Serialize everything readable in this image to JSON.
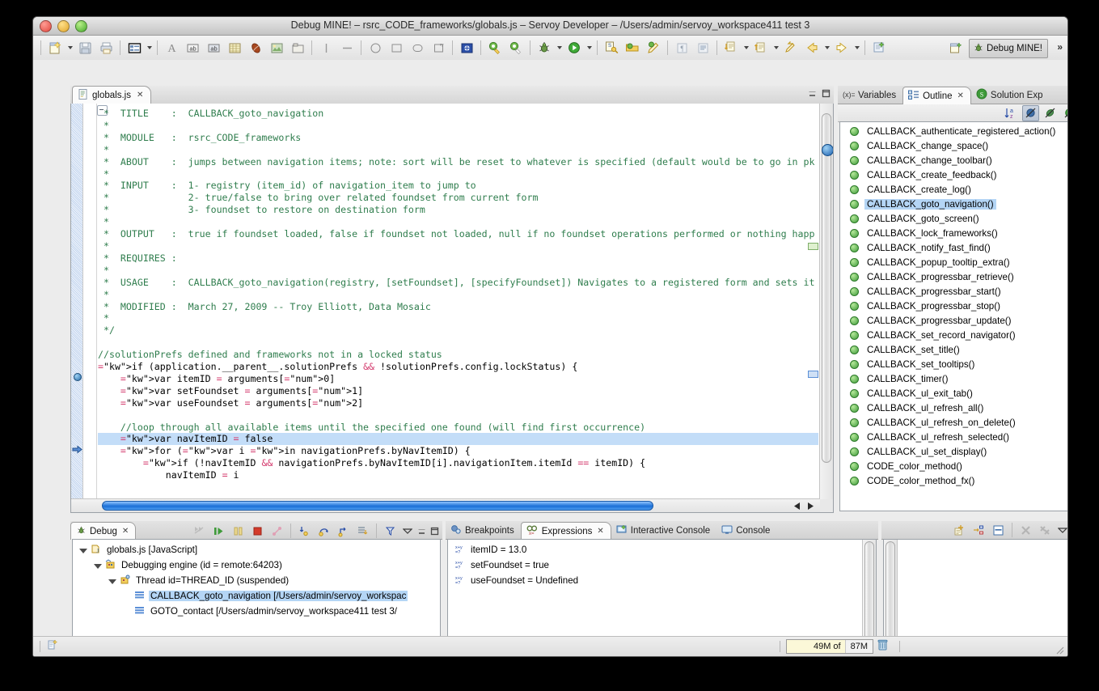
{
  "window": {
    "title": "Debug MINE! – rsrc_CODE_frameworks/globals.js – Servoy Developer – /Users/admin/servoy_workspace411 test 3",
    "controls": {
      "close": "close-button",
      "minimize": "minimize-button",
      "zoom": "zoom-button"
    }
  },
  "toolbar": {
    "groups": [
      {
        "items": [
          {
            "name": "new-wizard-icon",
            "label": "New",
            "dropdown": true
          },
          {
            "name": "save-icon",
            "label": "Save",
            "dropdown": false
          },
          {
            "name": "print-icon",
            "label": "Print",
            "dropdown": false
          }
        ]
      },
      {
        "items": [
          {
            "name": "form-editor-icon",
            "label": "New Form",
            "dropdown": true
          }
        ]
      },
      {
        "items": [
          {
            "name": "label-tool-icon",
            "label": "Place Label",
            "dropdown": false
          },
          {
            "name": "text-field-icon",
            "label": "Place Field",
            "dropdown": false
          },
          {
            "name": "text-area-icon",
            "label": "Place Text Area",
            "dropdown": false
          },
          {
            "name": "portal-icon",
            "label": "Place Portal",
            "dropdown": false
          },
          {
            "name": "bean-icon",
            "label": "Place Bean",
            "dropdown": false
          },
          {
            "name": "image-icon",
            "label": "Place Image",
            "dropdown": false
          },
          {
            "name": "tabpanel-icon",
            "label": "Place Tab Panel",
            "dropdown": false
          }
        ]
      },
      {
        "items": [
          {
            "name": "vertical-line-icon",
            "label": "Vertical Line",
            "dropdown": false
          },
          {
            "name": "horizontal-line-icon",
            "label": "Horizontal Line",
            "dropdown": false
          }
        ]
      },
      {
        "items": [
          {
            "name": "circle-shape-icon",
            "label": "Circle",
            "dropdown": false
          },
          {
            "name": "rect-shape-icon",
            "label": "Rectangle",
            "dropdown": false
          },
          {
            "name": "rounded-rect-icon",
            "label": "Rounded Rect",
            "dropdown": false
          },
          {
            "name": "polygon-icon",
            "label": "Polygon",
            "dropdown": false
          }
        ]
      },
      {
        "items": [
          {
            "name": "i18n-flag-icon",
            "label": "I18N",
            "dropdown": false
          }
        ]
      },
      {
        "items": [
          {
            "name": "profile-yellow-icon",
            "label": "Profile",
            "dropdown": false
          },
          {
            "name": "profile-white-icon",
            "label": "Profile Method",
            "dropdown": false
          }
        ]
      },
      {
        "items": [
          {
            "name": "debug-bug-icon",
            "label": "Debug",
            "dropdown": true
          },
          {
            "name": "run-play-icon",
            "label": "Run",
            "dropdown": true
          }
        ]
      },
      {
        "items": [
          {
            "name": "solution-key-icon",
            "label": "Solution",
            "dropdown": false
          },
          {
            "name": "open-folder-icon",
            "label": "Open",
            "dropdown": false
          },
          {
            "name": "pencil-edit-icon",
            "label": "Edit",
            "dropdown": false
          }
        ]
      },
      {
        "items": [
          {
            "name": "paragraph-mark-icon",
            "label": "Show Whitespace",
            "dropdown": false
          },
          {
            "name": "page-break-icon",
            "label": "Page Break",
            "dropdown": false
          }
        ]
      },
      {
        "items": [
          {
            "name": "next-annotation-icon",
            "label": "Next Annotation",
            "dropdown": true
          },
          {
            "name": "previous-annotation-icon",
            "label": "Previous Annotation",
            "dropdown": true
          },
          {
            "name": "last-edit-icon",
            "label": "Last Edit Location",
            "dropdown": false
          },
          {
            "name": "back-arrow-icon",
            "label": "Back",
            "dropdown": true
          },
          {
            "name": "forward-arrow-icon",
            "label": "Forward",
            "dropdown": true
          }
        ]
      },
      {
        "items": [
          {
            "name": "new-js-file-icon",
            "label": "New JS File",
            "dropdown": false
          }
        ]
      }
    ],
    "perspective": {
      "open_perspective_name": "open-perspective-icon",
      "active_label": "Debug MINE!",
      "active_icon": "debug-perspective-icon"
    },
    "overflow_label": "»"
  },
  "editor": {
    "tab": {
      "label": "globals.js",
      "icon": "js-file-icon",
      "close": "✕"
    },
    "minimize_icon": "minimize-icon",
    "maximize_icon": "maximize-icon",
    "code_lines": [
      {
        "t": "comment",
        "text": " *  TITLE    :  CALLBACK_goto_navigation"
      },
      {
        "t": "comment",
        "text": " *"
      },
      {
        "t": "comment",
        "text": " *  MODULE   :  rsrc_CODE_frameworks"
      },
      {
        "t": "comment",
        "text": " *"
      },
      {
        "t": "comment",
        "text": " *  ABOUT    :  jumps between navigation items; note: sort will be reset to whatever is specified (default would be to go in pk"
      },
      {
        "t": "comment",
        "text": " *"
      },
      {
        "t": "comment",
        "text": " *  INPUT    :  1- registry (item_id) of navigation_item to jump to"
      },
      {
        "t": "comment",
        "text": " *              2- true/false to bring over related foundset from current form"
      },
      {
        "t": "comment",
        "text": " *              3- foundset to restore on destination form"
      },
      {
        "t": "comment",
        "text": " *"
      },
      {
        "t": "comment",
        "text": " *  OUTPUT   :  true if foundset loaded, false if foundset not loaded, null if no foundset operations performed or nothing happ"
      },
      {
        "t": "comment",
        "text": " *"
      },
      {
        "t": "comment",
        "text": " *  REQUIRES :"
      },
      {
        "t": "comment",
        "text": " *"
      },
      {
        "t": "comment",
        "text": " *  USAGE    :  CALLBACK_goto_navigation(registry, [setFoundset], [specifyFoundset]) Navigates to a registered form and sets it"
      },
      {
        "t": "comment",
        "text": " *"
      },
      {
        "t": "comment",
        "text": " *  MODIFIED :  March 27, 2009 -- Troy Elliott, Data Mosaic"
      },
      {
        "t": "comment",
        "text": " *"
      },
      {
        "t": "comment",
        "text": " */"
      },
      {
        "t": "blank",
        "text": ""
      },
      {
        "t": "comment",
        "text": "//solutionPrefs defined and frameworks not in a locked status"
      },
      {
        "t": "code",
        "text": "if (application.__parent__.solutionPrefs && !solutionPrefs.config.lockStatus) {",
        "breakpoint": true
      },
      {
        "t": "code",
        "text": "    var itemID = arguments[0]"
      },
      {
        "t": "code",
        "text": "    var setFoundset = arguments[1]"
      },
      {
        "t": "code",
        "text": "    var useFoundset = arguments[2]"
      },
      {
        "t": "blank",
        "text": ""
      },
      {
        "t": "comment",
        "text": "    //loop through all available items until the specified one found (will find first occurrence)"
      },
      {
        "t": "code",
        "text": "    var navItemID = false",
        "highlight": true,
        "ip": true
      },
      {
        "t": "code",
        "text": "    for (var i in navigationPrefs.byNavItemID) {"
      },
      {
        "t": "code",
        "text": "        if (!navItemID && navigationPrefs.byNavItemID[i].navigationItem.itemId == itemID) {"
      },
      {
        "t": "code",
        "text": "            navItemID = i"
      }
    ]
  },
  "outline": {
    "tabs": [
      {
        "label": "Variables",
        "icon": "variables-icon",
        "active": false
      },
      {
        "label": "Outline",
        "icon": "outline-icon",
        "active": true,
        "close": "✕"
      },
      {
        "label": "Solution Exp",
        "icon": "solution-explorer-icon",
        "active": false
      }
    ],
    "toolbar": [
      {
        "name": "sort-az-icon",
        "label": "Sort",
        "toggled": false
      },
      {
        "name": "hide-non-public-icon",
        "label": "Hide Non-Public Members",
        "toggled": true
      },
      {
        "name": "hide-static-icon",
        "label": "Hide Static Members",
        "toggled": false
      },
      {
        "name": "hide-fields-icon",
        "label": "Hide Fields",
        "toggled": false
      },
      {
        "name": "view-menu-icon",
        "label": "View Menu",
        "toggled": false
      }
    ],
    "items": [
      {
        "label": "CALLBACK_authenticate_registered_action()",
        "selected": false
      },
      {
        "label": "CALLBACK_change_space()",
        "selected": false
      },
      {
        "label": "CALLBACK_change_toolbar()",
        "selected": false
      },
      {
        "label": "CALLBACK_create_feedback()",
        "selected": false
      },
      {
        "label": "CALLBACK_create_log()",
        "selected": false
      },
      {
        "label": "CALLBACK_goto_navigation()",
        "selected": true
      },
      {
        "label": "CALLBACK_goto_screen()",
        "selected": false
      },
      {
        "label": "CALLBACK_lock_frameworks()",
        "selected": false
      },
      {
        "label": "CALLBACK_notify_fast_find()",
        "selected": false
      },
      {
        "label": "CALLBACK_popup_tooltip_extra()",
        "selected": false
      },
      {
        "label": "CALLBACK_progressbar_retrieve()",
        "selected": false
      },
      {
        "label": "CALLBACK_progressbar_start()",
        "selected": false
      },
      {
        "label": "CALLBACK_progressbar_stop()",
        "selected": false
      },
      {
        "label": "CALLBACK_progressbar_update()",
        "selected": false
      },
      {
        "label": "CALLBACK_set_record_navigator()",
        "selected": false
      },
      {
        "label": "CALLBACK_set_title()",
        "selected": false
      },
      {
        "label": "CALLBACK_set_tooltips()",
        "selected": false
      },
      {
        "label": "CALLBACK_timer()",
        "selected": false
      },
      {
        "label": "CALLBACK_ul_exit_tab()",
        "selected": false
      },
      {
        "label": "CALLBACK_ul_refresh_all()",
        "selected": false
      },
      {
        "label": "CALLBACK_ul_refresh_on_delete()",
        "selected": false
      },
      {
        "label": "CALLBACK_ul_refresh_selected()",
        "selected": false
      },
      {
        "label": "CALLBACK_ul_set_display()",
        "selected": false
      },
      {
        "label": "CODE_color_method()",
        "selected": false
      },
      {
        "label": "CODE_color_method_fx()",
        "selected": false
      }
    ]
  },
  "debug_view": {
    "tab": {
      "label": "Debug",
      "icon": "debug-perspective-icon",
      "close": "✕"
    },
    "toolbar": [
      {
        "name": "resume-all-icon",
        "label": "Resume All",
        "enabled": false
      },
      {
        "name": "resume-icon",
        "label": "Resume",
        "enabled": true
      },
      {
        "name": "suspend-icon",
        "label": "Suspend",
        "enabled": false
      },
      {
        "name": "terminate-icon",
        "label": "Terminate",
        "enabled": true
      },
      {
        "name": "disconnect-icon",
        "label": "Disconnect",
        "enabled": false
      },
      {
        "name": "step-into-icon",
        "label": "Step Into",
        "enabled": true
      },
      {
        "name": "step-over-icon",
        "label": "Step Over",
        "enabled": true
      },
      {
        "name": "step-return-icon",
        "label": "Step Return",
        "enabled": true
      },
      {
        "name": "drop-to-frame-icon",
        "label": "Drop To Frame",
        "enabled": true
      },
      {
        "name": "use-step-filters-icon",
        "label": "Use Step Filters",
        "enabled": true
      },
      {
        "name": "view-menu-icon",
        "label": "View Menu",
        "enabled": true
      }
    ],
    "tree": [
      {
        "indent": 0,
        "arrow": true,
        "icon": "launch-js-icon",
        "label": "globals.js [JavaScript]",
        "selected": false
      },
      {
        "indent": 1,
        "arrow": true,
        "icon": "debug-target-icon",
        "label": "Debugging engine (id = remote:64203)",
        "selected": false
      },
      {
        "indent": 2,
        "arrow": true,
        "icon": "thread-icon",
        "label": "Thread id=THREAD_ID (suspended)",
        "selected": false
      },
      {
        "indent": 3,
        "arrow": false,
        "icon": "stack-frame-icon",
        "label": "CALLBACK_goto_navigation [/Users/admin/servoy_workspac",
        "selected": true
      },
      {
        "indent": 3,
        "arrow": false,
        "icon": "stack-frame-icon",
        "label": "GOTO_contact [/Users/admin/servoy_workspace411 test 3/",
        "selected": false
      }
    ]
  },
  "expressions": {
    "tabs": [
      {
        "label": "Breakpoints",
        "icon": "breakpoints-icon",
        "active": false
      },
      {
        "label": "Expressions",
        "icon": "expressions-icon",
        "active": true,
        "close": "✕"
      },
      {
        "label": "Interactive Console",
        "icon": "interactive-console-icon",
        "active": false
      },
      {
        "label": "Console",
        "icon": "console-icon",
        "active": false
      }
    ],
    "toolbar": [
      {
        "name": "add-watch-expression-icon",
        "label": "Add Watch Expression"
      },
      {
        "name": "collapse-expand-icon",
        "label": "Show Logical Structure"
      },
      {
        "name": "show-details-pane-icon",
        "label": "Layout"
      },
      {
        "name": "remove-expression-icon",
        "label": "Remove Selected",
        "enabled": false
      },
      {
        "name": "remove-all-expressions-icon",
        "label": "Remove All",
        "enabled": false
      },
      {
        "name": "view-menu-icon",
        "label": "View Menu"
      },
      {
        "name": "minimize-icon",
        "label": "Minimize"
      },
      {
        "name": "maximize-icon",
        "label": "Maximize"
      }
    ],
    "items": [
      {
        "icon": "watch-expression-icon",
        "label": "itemID = 13.0"
      },
      {
        "icon": "watch-expression-icon",
        "label": "setFoundset = true"
      },
      {
        "icon": "watch-expression-icon",
        "label": "useFoundset = Undefined"
      }
    ]
  },
  "status_bar": {
    "left_icon": "editor-state-icon",
    "heap_used": "49M of",
    "heap_total": "87M",
    "trash_icon": "run-gc-trash-icon"
  },
  "colors": {
    "selection": "#b4d5f5",
    "comment_green": "#2f7d4d",
    "keyword_purple": "#7f0055",
    "operator_pink": "#d43b6e",
    "number_blue": "#1515d0",
    "scroll_blue": "#1b6fd6"
  }
}
